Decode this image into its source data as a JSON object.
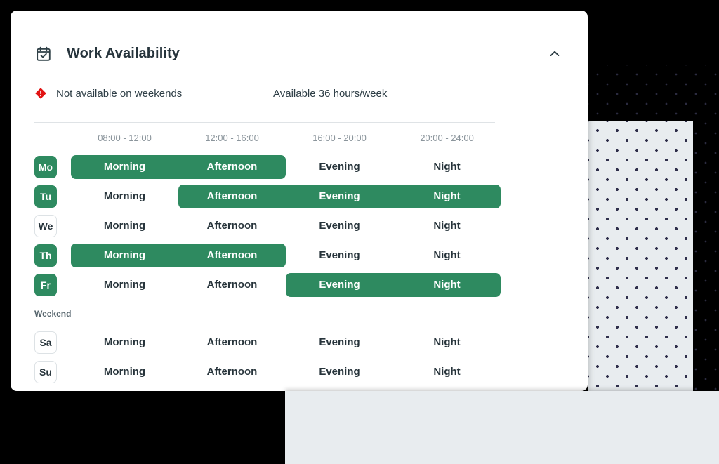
{
  "card": {
    "title": "Work Availability",
    "header_icon": "calendar-check-icon",
    "collapse_icon": "chevron-up-icon"
  },
  "status": {
    "warning_icon": "warning-diamond-icon",
    "warning_text": "Not available on weekends",
    "hours_text": "Available 36 hours/week"
  },
  "slot_headers": [
    "08:00 - 12:00",
    "12:00 - 16:00",
    "16:00 - 20:00",
    "20:00 - 24:00"
  ],
  "slot_names": [
    "Morning",
    "Afternoon",
    "Evening",
    "Night"
  ],
  "weekend_label": "Weekend",
  "weekdays": [
    {
      "day": "Mo",
      "day_active": true,
      "slots": [
        true,
        true,
        false,
        false
      ]
    },
    {
      "day": "Tu",
      "day_active": true,
      "slots": [
        false,
        true,
        true,
        true
      ]
    },
    {
      "day": "We",
      "day_active": false,
      "slots": [
        false,
        false,
        false,
        false
      ]
    },
    {
      "day": "Th",
      "day_active": true,
      "slots": [
        true,
        true,
        false,
        false
      ]
    },
    {
      "day": "Fr",
      "day_active": true,
      "slots": [
        false,
        false,
        true,
        true
      ]
    }
  ],
  "weekend_days": [
    {
      "day": "Sa",
      "day_active": false,
      "slots": [
        false,
        false,
        false,
        false
      ]
    },
    {
      "day": "Su",
      "day_active": false,
      "slots": [
        false,
        false,
        false,
        false
      ]
    }
  ],
  "colors": {
    "accent_green": "#2e8a60",
    "warning_red": "#e11313",
    "text_dark": "#27343b",
    "text_muted": "#8b959c",
    "panel_gray": "#e8ecef"
  }
}
